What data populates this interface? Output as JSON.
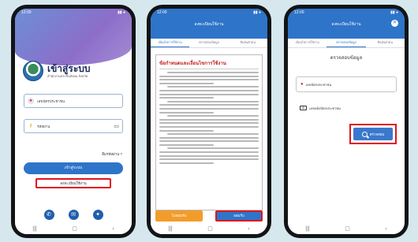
{
  "phone1": {
    "status_time": "12:00",
    "title": "เข้าสู่ระบบ",
    "subtitle": "สำนักงานประกันสังคม จังหวัด",
    "username_placeholder": "เลขบัตรประชาชน",
    "password_placeholder": "รหัสผ่าน",
    "forgot_label": "ลืมรหัสผ่าน ?",
    "login_label": "เข้าสู่ระบบ",
    "register_label": "ลงทะเบียนใช้งาน",
    "contact_icons": [
      "phone-icon",
      "chat-icon",
      "messenger-icon"
    ]
  },
  "phone2": {
    "status_time": "12:00",
    "header_title": "ลงทะเบียนใช้งาน",
    "tabs": [
      "เงื่อนไขการใช้งาน",
      "ตรวจสอบข้อมูล",
      "ยืนยันตัวตน"
    ],
    "terms_title": "ข้อกำหนดและเงื่อนไขการใช้งาน",
    "decline_label": "ไม่ยอมรับ",
    "accept_label": "ยอมรับ"
  },
  "phone3": {
    "status_time": "12:00",
    "header_title": "ลงทะเบียนใช้งาน",
    "tabs": [
      "เงื่อนไขการใช้งาน",
      "ตรวจสอบข้อมูล",
      "ยืนยันตัวตน"
    ],
    "section_title": "ตรวจสอบข้อมูล",
    "id_field_label": "เลขบัตรประชาชน",
    "laser_label": "เลขหลังบัตรประชาชน",
    "search_label": "ตรวจสอบ"
  },
  "colors": {
    "primary_blue": "#2e74c9",
    "highlight_red": "#e0141c",
    "accent_orange": "#f39c2a"
  }
}
